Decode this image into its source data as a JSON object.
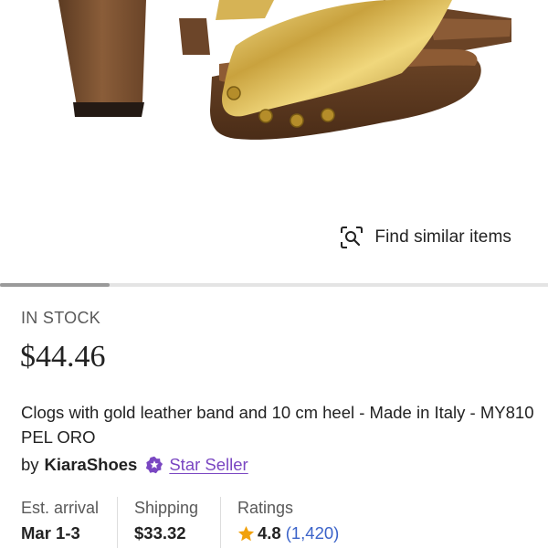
{
  "product": {
    "image_alt": "Gold leather band clog sandal with wooden platform and heel",
    "stock_status": "IN STOCK",
    "price": "$44.46",
    "title": "Clogs with gold leather band and 10 cm heel - Made in Italy - MY810 PEL ORO"
  },
  "actions": {
    "find_similar_label": "Find similar items"
  },
  "seller": {
    "by_label": "by",
    "name": "KiaraShoes",
    "badge_label": "Star Seller"
  },
  "details": {
    "arrival": {
      "label": "Est. arrival",
      "value": "Mar 1-3"
    },
    "shipping": {
      "label": "Shipping",
      "value": "$33.32"
    },
    "ratings": {
      "label": "Ratings",
      "score": "4.8",
      "count": "(1,420)"
    }
  },
  "gallery": {
    "scroll_progress": 0.2
  },
  "colors": {
    "star_seller_purple": "#7a47c2",
    "rating_star_orange": "#f1a10a",
    "link_blue": "#3b63c9",
    "muted_text": "#595959"
  },
  "icons": {
    "find_similar": "visual-search-icon",
    "star_seller": "star-badge-icon",
    "rating": "star-icon"
  }
}
